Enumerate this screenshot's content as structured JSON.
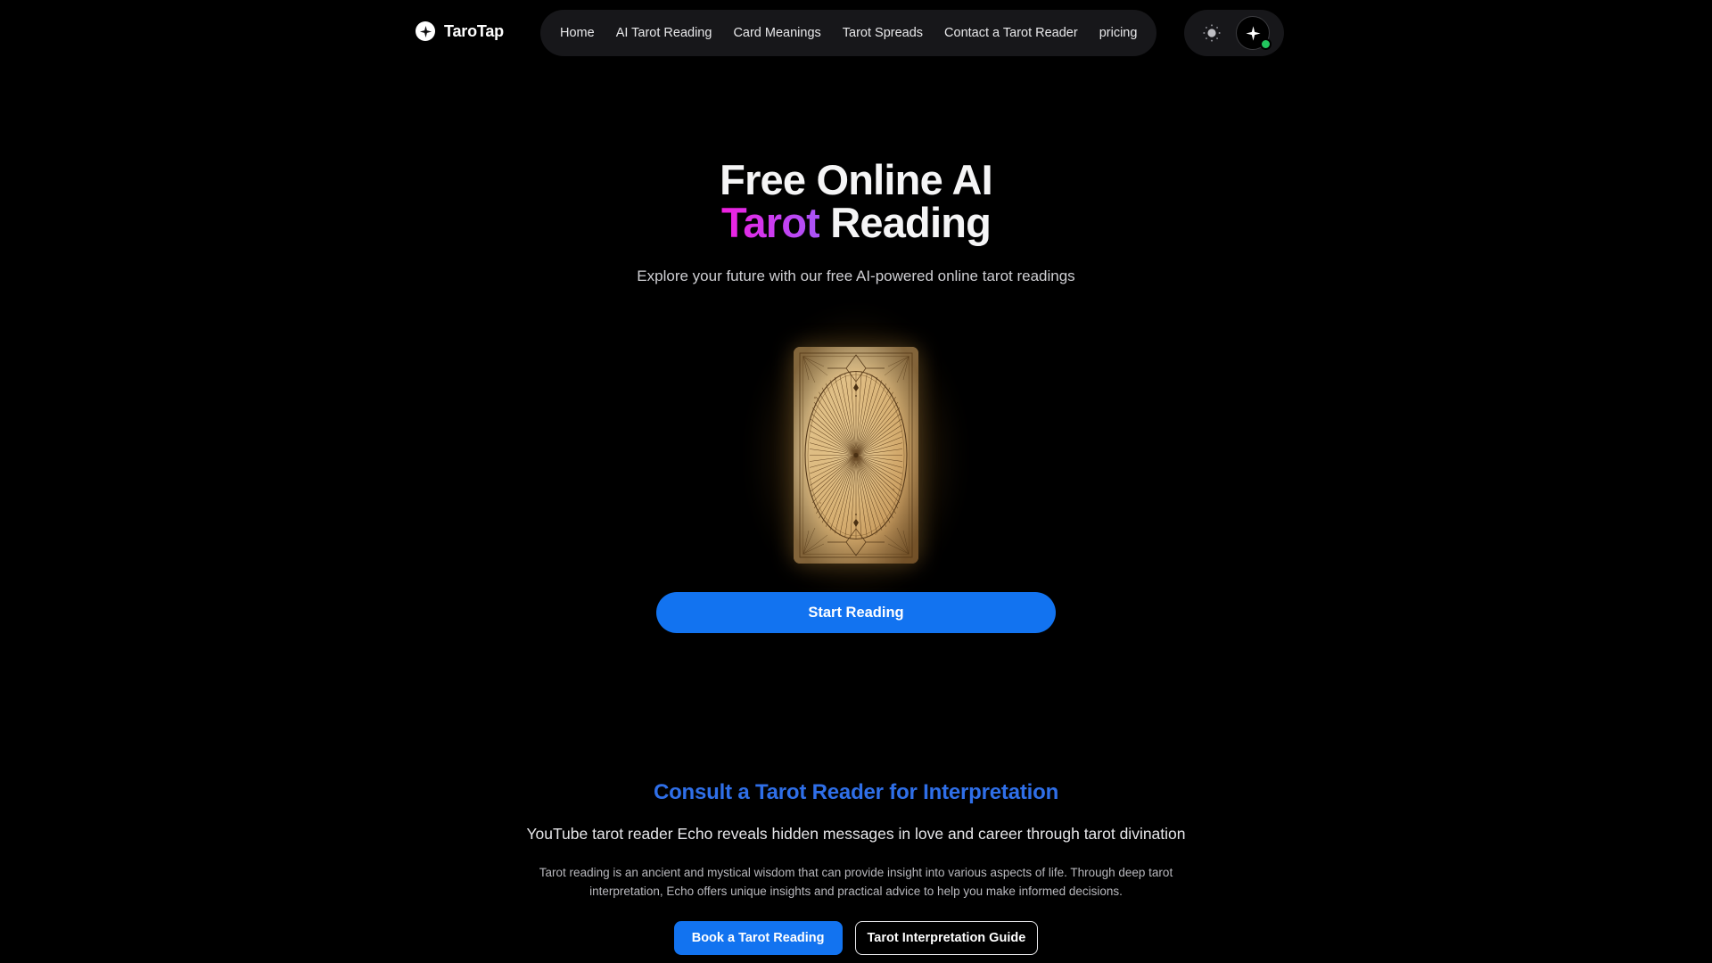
{
  "theme": {
    "background": "#000000",
    "accent_blue": "#1273f0",
    "heading_blue": "#2f6fe8",
    "accent_magenta": "#f11fe0",
    "accent_purple": "#a855f7",
    "status_green": "#22c55e",
    "pill_background": "#17171a"
  },
  "header": {
    "brand": {
      "name": "TaroTap",
      "icon": "four-point-star-icon"
    },
    "nav": [
      {
        "label": "Home"
      },
      {
        "label": "AI Tarot Reading"
      },
      {
        "label": "Card Meanings"
      },
      {
        "label": "Tarot Spreads"
      },
      {
        "label": "Contact a Tarot Reader"
      },
      {
        "label": "pricing"
      }
    ],
    "actions": {
      "theme_toggle_icon": "sun-icon",
      "ai_assistant_icon": "sparkle-icon",
      "status_indicator": "online"
    }
  },
  "hero": {
    "title_line1": "Free Online AI",
    "title_accent": "Tarot",
    "title_line2_rest": " Reading",
    "subtitle": "Explore your future with our free AI-powered online tarot readings",
    "card": {
      "name": "tarot-card-back",
      "description": "Vintage parchment tarot card back with radial sunburst pattern"
    },
    "cta_label": "Start Reading"
  },
  "consult": {
    "title": "Consult a Tarot Reader for Interpretation",
    "lead": "YouTube tarot reader Echo reveals hidden messages in love and career through tarot divination",
    "body": "Tarot reading is an ancient and mystical wisdom that can provide insight into various aspects of life. Through deep tarot interpretation, Echo offers unique insights and practical advice to help you make informed decisions.",
    "primary_button": "Book a Tarot Reading",
    "secondary_button": "Tarot Interpretation Guide"
  }
}
